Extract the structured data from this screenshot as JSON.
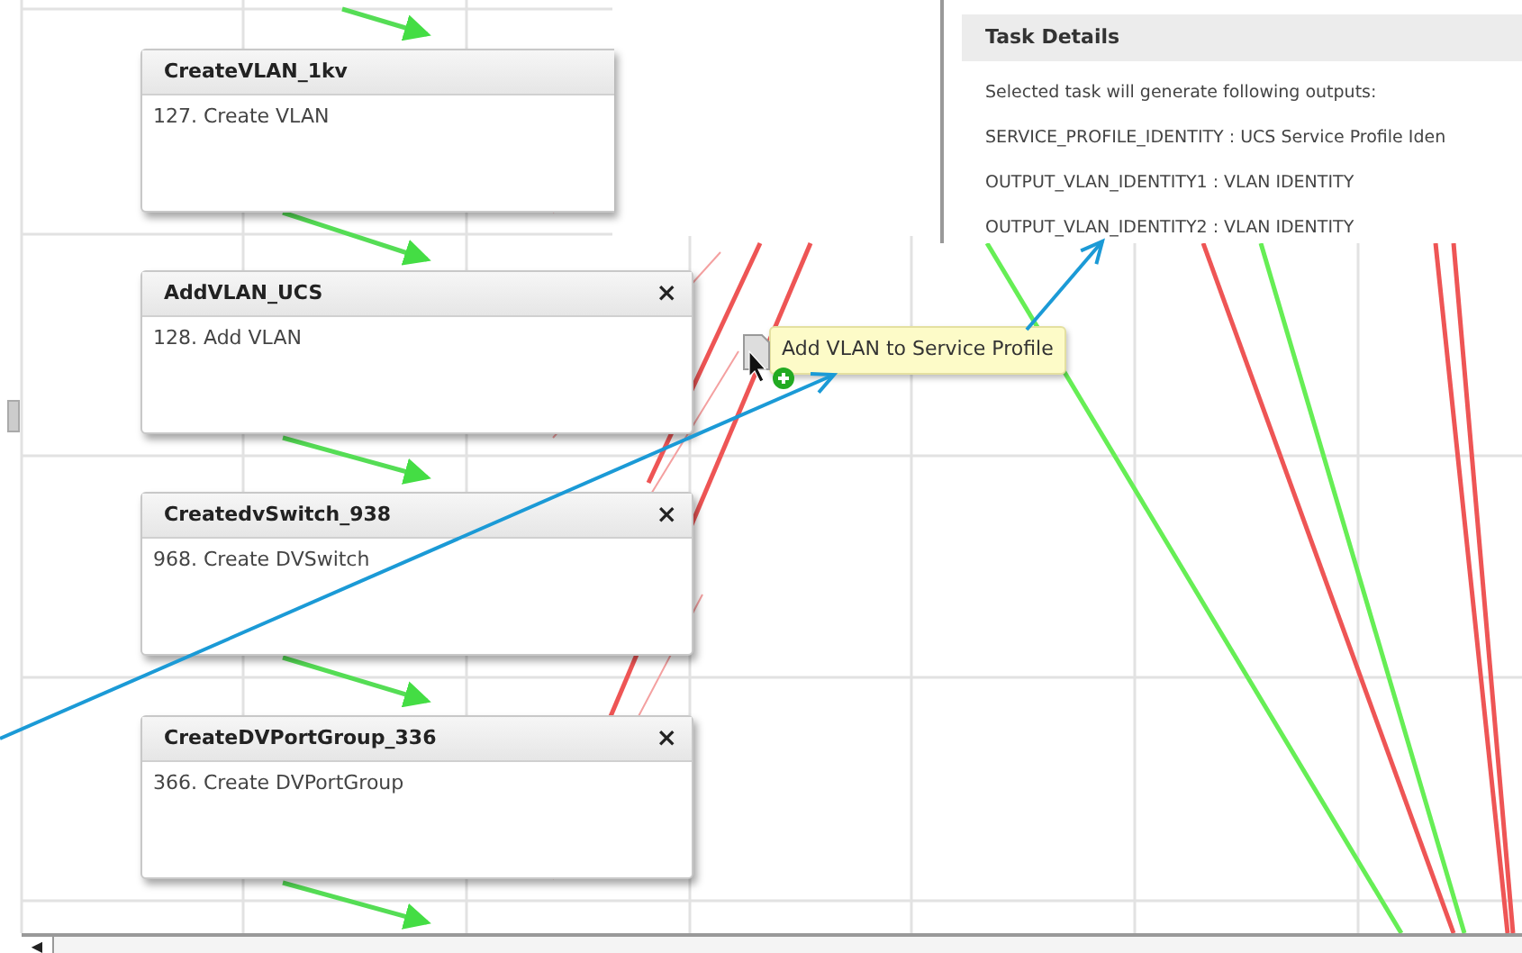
{
  "workflow_nodes": [
    {
      "title": "CreateVLAN_1kv",
      "description": "127. Create VLAN",
      "close_button": false
    },
    {
      "title": "AddVLAN_UCS",
      "description": "128. Add VLAN",
      "close_button": true
    },
    {
      "title": "CreatedvSwitch_938",
      "description": "968. Create DVSwitch",
      "close_button": true
    },
    {
      "title": "CreateDVPortGroup_336",
      "description": "366. Create DVPortGroup",
      "close_button": true
    }
  ],
  "close_symbol": "×",
  "drag_tooltip": {
    "text": "Add VLAN to Service Profile"
  },
  "task_details": {
    "title": "Task Details",
    "intro": "Selected task will generate following outputs:",
    "outputs": [
      "SERVICE_PROFILE_IDENTITY : UCS Service Profile Iden",
      "OUTPUT_VLAN_IDENTITY1 : VLAN IDENTITY",
      "OUTPUT_VLAN_IDENTITY2 : VLAN IDENTITY"
    ]
  },
  "scroll_left_symbol": "◀"
}
